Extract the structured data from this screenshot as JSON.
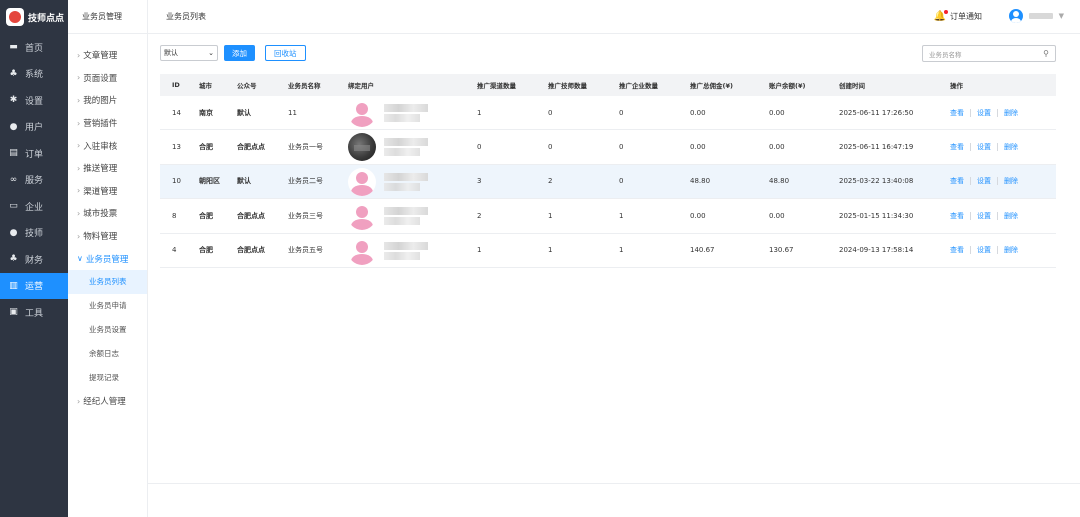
{
  "brand": {
    "name": "技师点点",
    "accent": "#1e90ff",
    "logo_color": "#e4463d"
  },
  "sidebar": {
    "items": [
      {
        "label": "首页",
        "icon": "monitor-icon"
      },
      {
        "label": "系统",
        "icon": "sitemap-icon"
      },
      {
        "label": "设置",
        "icon": "gear-icon"
      },
      {
        "label": "用户",
        "icon": "user-icon"
      },
      {
        "label": "订单",
        "icon": "clipboard-icon"
      },
      {
        "label": "服务",
        "icon": "link-icon"
      },
      {
        "label": "企业",
        "icon": "building-icon"
      },
      {
        "label": "技师",
        "icon": "user-icon"
      },
      {
        "label": "财务",
        "icon": "sitemap-icon"
      },
      {
        "label": "运营",
        "icon": "chart-icon",
        "active": true
      },
      {
        "label": "工具",
        "icon": "briefcase-icon"
      }
    ]
  },
  "submenu": {
    "title": "业务员管理",
    "items": [
      {
        "label": "文章管理"
      },
      {
        "label": "页面设置"
      },
      {
        "label": "我的图片"
      },
      {
        "label": "营销插件"
      },
      {
        "label": "入驻审核"
      },
      {
        "label": "推送管理"
      },
      {
        "label": "渠道管理"
      },
      {
        "label": "城市投票"
      },
      {
        "label": "物料管理"
      },
      {
        "label": "业务员管理",
        "open": true
      }
    ],
    "children": [
      {
        "label": "业务员列表",
        "active": true
      },
      {
        "label": "业务员申请"
      },
      {
        "label": "业务员设置"
      },
      {
        "label": "余额日志"
      },
      {
        "label": "提现记录"
      }
    ],
    "after": [
      {
        "label": "经纪人管理"
      }
    ]
  },
  "topbar": {
    "title": "业务员列表",
    "notify_label": "订单通知"
  },
  "toolbar": {
    "select_value": "默认",
    "add_label": "添加",
    "recycle_label": "回收站",
    "search_placeholder": "业务员名称"
  },
  "table": {
    "headers": [
      "ID",
      "城市",
      "公众号",
      "业务员名称",
      "绑定用户",
      "推广渠道数量",
      "推广技师数量",
      "推广企业数量",
      "推广总佣金(¥)",
      "账户余额(¥)",
      "创建时间",
      "操作"
    ],
    "rows": [
      {
        "id": "14",
        "city": "南京",
        "gzh": "默认",
        "name": "11",
        "avatar": "pink",
        "qd": "1",
        "js": "0",
        "qy": "0",
        "yj": "0.00",
        "ye": "0.00",
        "time": "2025-06-11 17:26:50"
      },
      {
        "id": "13",
        "city": "合肥",
        "gzh": "合肥点点",
        "name": "业务员一号",
        "avatar": "photo",
        "qd": "0",
        "js": "0",
        "qy": "0",
        "yj": "0.00",
        "ye": "0.00",
        "time": "2025-06-11 16:47:19"
      },
      {
        "id": "10",
        "city": "朝阳区",
        "gzh": "默认",
        "name": "业务员二号",
        "avatar": "pink",
        "qd": "3",
        "js": "2",
        "qy": "0",
        "yj": "48.80",
        "ye": "48.80",
        "time": "2025-03-22 13:40:08",
        "highlight": true
      },
      {
        "id": "8",
        "city": "合肥",
        "gzh": "合肥点点",
        "name": "业务员三号",
        "avatar": "pink",
        "qd": "2",
        "js": "1",
        "qy": "1",
        "yj": "0.00",
        "ye": "0.00",
        "time": "2025-01-15 11:34:30"
      },
      {
        "id": "4",
        "city": "合肥",
        "gzh": "合肥点点",
        "name": "业务员五号",
        "avatar": "pink",
        "qd": "1",
        "js": "1",
        "qy": "1",
        "yj": "140.67",
        "ye": "130.67",
        "time": "2024-09-13 17:58:14"
      }
    ],
    "actions": {
      "view": "查看",
      "settings": "设置",
      "delete": "删除"
    }
  }
}
